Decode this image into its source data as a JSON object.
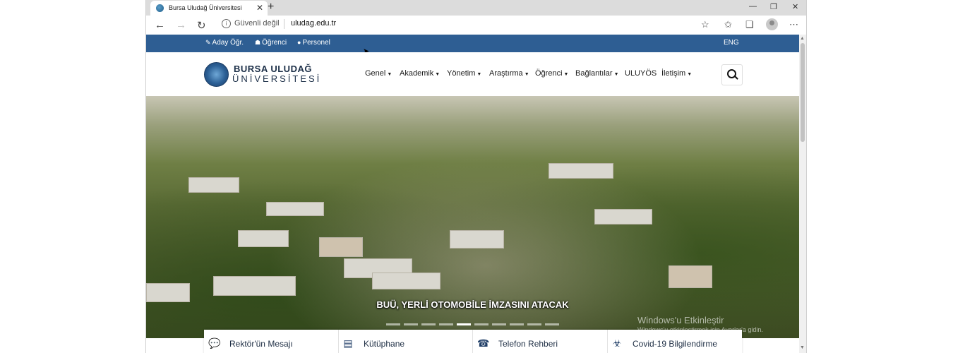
{
  "browser": {
    "tab_title": "Bursa Uludağ Üniversitesi",
    "tab_close": "✕",
    "new_tab": "+",
    "win_min": "—",
    "win_restore": "❐",
    "win_close": "✕",
    "security_label": "Güvenli değil",
    "url": "uludag.edu.tr",
    "back": "←",
    "forward": "→",
    "reload": "↻",
    "more": "⋯"
  },
  "topbar": {
    "links": [
      {
        "label": "Aday Öğr.",
        "icon": "graduate-icon"
      },
      {
        "label": "Öğrenci",
        "icon": "student-icon"
      },
      {
        "label": "Personel",
        "icon": "user-icon"
      }
    ],
    "lang": "ENG",
    "color": "#2e5e93"
  },
  "logo": {
    "line1": "BURSA ULUDAĞ",
    "line2": "ÜNİVERSİTESİ"
  },
  "menu": [
    {
      "label": "Genel",
      "dropdown": true
    },
    {
      "label": "Akademik",
      "dropdown": true
    },
    {
      "label": "Yönetim",
      "dropdown": true
    },
    {
      "label": "Araştırma",
      "dropdown": true
    },
    {
      "label": "Öğrenci",
      "dropdown": true
    },
    {
      "label": "Bağlantılar",
      "dropdown": true
    },
    {
      "label": "ULUYÖS",
      "dropdown": false
    },
    {
      "label": "İletişim",
      "dropdown": true
    }
  ],
  "hero": {
    "caption": "BUÜ, YERLİ OTOMOBİLE İMZASINI ATACAK",
    "slides": 10,
    "active_slide": 4
  },
  "watermark": {
    "line1": "Windows'u Etkinleştir",
    "line2": "Windows'u etkinleştirmek için Ayarlar'a gidin."
  },
  "quick_links": [
    {
      "label": "Rektör'ün Mesajı",
      "icon": "speech-bubble-icon"
    },
    {
      "label": "Kütüphane",
      "icon": "books-icon"
    },
    {
      "label": "Telefon Rehberi",
      "icon": "phone-book-icon"
    },
    {
      "label": "Covid-19 Bilgilendirme",
      "icon": "biohazard-icon"
    }
  ]
}
